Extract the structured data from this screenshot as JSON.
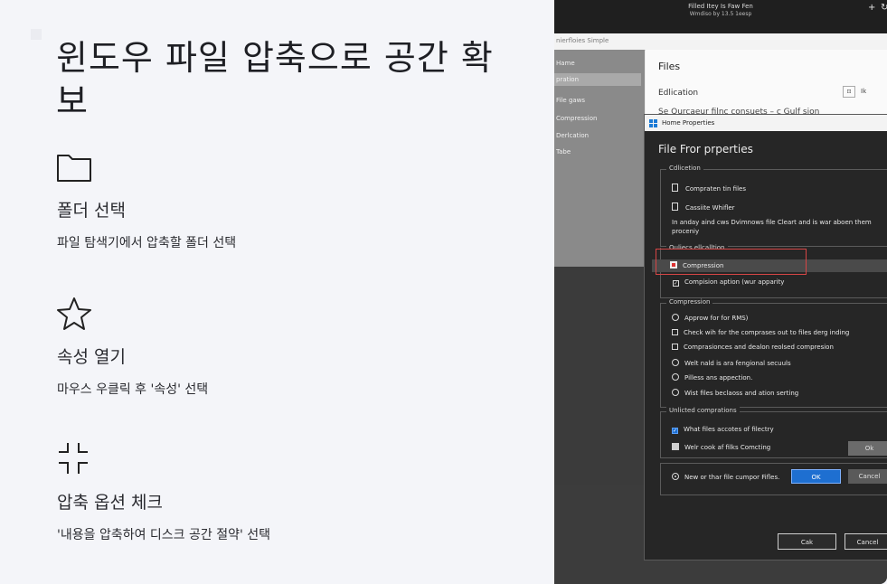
{
  "guide": {
    "title": "윈도우 파일 압축으로 공간 확보",
    "steps": [
      {
        "icon": "folder-icon",
        "title": "폴더 선택",
        "description": "파일 탐색기에서 압축할 폴더 선택"
      },
      {
        "icon": "star-icon",
        "title": "속성 열기",
        "description": "마우스 우클릭 후 '속성' 선택"
      },
      {
        "icon": "compress-icon",
        "title": "압축 옵션 체크",
        "description": "'내용을 압축하여 디스크 공간 절약' 선택"
      }
    ]
  },
  "screenshot": {
    "window_title": "Filled Itey Is Faw Fen",
    "window_subtitle": "Wmdiso by 13.5 1eesp",
    "add_label": "+",
    "explorer": {
      "path": "nierfloies Simple",
      "nav_items": [
        "Hame",
        "pration",
        "File gaws",
        "Compression",
        "Derlcation",
        "Tabe"
      ],
      "main_title": "Files",
      "edit_label": "Edlication",
      "edit_link": "Ik",
      "cut_text": "Se      Qurcaeur filnc consuets – c Gulf sion"
    },
    "dialog": {
      "title": "Home Properties",
      "heading": "File Fror prperties",
      "group1": {
        "legend": "Cdlicetion",
        "items": [
          "Compraten tin files",
          "Cassiite Whifler"
        ],
        "note": "In anday aind cws Dvimnows file Cleart and is war aboen them proceniy"
      },
      "group2": {
        "legend": "Ouliecs ellcalltion",
        "highlighted": "Compression",
        "option": "Compision aption (wur apparity"
      },
      "group3": {
        "legend": "Compression",
        "items": [
          {
            "type": "radio",
            "label": "Approw for for RMS)"
          },
          {
            "type": "checkbox",
            "label": "Check wih for the comprases out to files derg inding"
          },
          {
            "type": "checkbox",
            "label": "Comprasionces and dealon reolsed compresion"
          },
          {
            "type": "radio",
            "label": "Welt nald is ara fengional secuuls"
          },
          {
            "type": "radio",
            "label": "Pilless ans appection."
          },
          {
            "type": "radio",
            "label": "Wist files beclaoss and ation serting"
          }
        ]
      },
      "group4": {
        "legend": "Unlicted comprations",
        "item1": "What files accotes of filectry",
        "item2": "Welr cook af filks Comcting",
        "item2_button": "Ok"
      },
      "footer_option": "New or thar file cumpor Fifles.",
      "ok_label": "OK",
      "cancel_label": "Cancel",
      "bottom_ok": "Cak",
      "bottom_cancel": "Cancel"
    }
  },
  "colors": {
    "accent": "#1e6fd1",
    "highlight_box": "#d64545",
    "dialog_bg": "#262626",
    "guide_bg": "#f4f5f9"
  }
}
